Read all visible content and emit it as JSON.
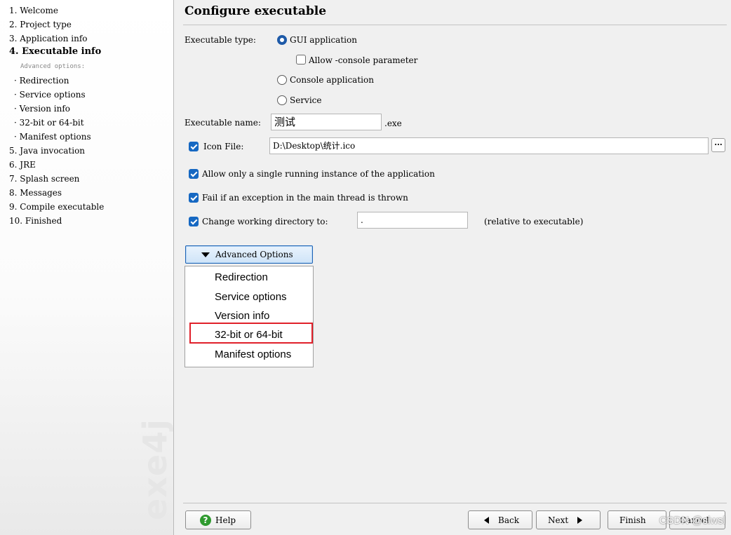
{
  "sidebar": {
    "steps": [
      {
        "label": "1. Welcome"
      },
      {
        "label": "2. Project type"
      },
      {
        "label": "3. Application info"
      },
      {
        "label": "4. Executable info"
      },
      {
        "label": "5. Java invocation"
      },
      {
        "label": "6. JRE"
      },
      {
        "label": "7. Splash screen"
      },
      {
        "label": "8. Messages"
      },
      {
        "label": "9. Compile executable"
      },
      {
        "label": "10. Finished"
      }
    ],
    "advanced_header": "Advanced options:",
    "sub_steps": [
      {
        "label": "· Redirection"
      },
      {
        "label": "· Service options"
      },
      {
        "label": "· Version info"
      },
      {
        "label": "· 32-bit or 64-bit"
      },
      {
        "label": "· Manifest options"
      }
    ],
    "logo_text": "exe4j"
  },
  "main": {
    "title": "Configure executable",
    "executable_type_label": "Executable type:",
    "options": {
      "gui": "GUI application",
      "allow_console": "Allow -console parameter",
      "console": "Console application",
      "service": "Service"
    },
    "executable_name_label": "Executable name:",
    "executable_name_value": "测试",
    "exe_suffix": ".exe",
    "icon_file_label": "Icon File:",
    "icon_file_value": "D:\\Desktop\\统计.ico",
    "browse_label": "...",
    "single_instance": "Allow only a single running instance of the application",
    "fail_on_exception": "Fail if an exception in the main thread is thrown",
    "change_dir_label": "Change working directory to:",
    "change_dir_value": ".",
    "relative_note": "(relative to executable)",
    "advanced_button": "Advanced Options",
    "advanced_menu": [
      {
        "label": "Redirection"
      },
      {
        "label": "Service options"
      },
      {
        "label": "Version info"
      },
      {
        "label": "32-bit or 64-bit"
      },
      {
        "label": "Manifest options"
      }
    ]
  },
  "footer": {
    "help": "Help",
    "back": "Back",
    "next": "Next",
    "finish": "Finish",
    "cancel": "Cancel",
    "watermark": "CSDN @siwsl"
  },
  "state": {
    "gui_selected": true,
    "allow_console_checked": false,
    "icon_file_checked": true,
    "single_instance_checked": true,
    "fail_on_exception_checked": true,
    "change_dir_checked": true,
    "highlighted_menu_item": "32-bit or 64-bit"
  },
  "colors": {
    "accent": "#1668c2",
    "highlight_box": "#e0202a",
    "help_icon": "#2f9a2f"
  }
}
